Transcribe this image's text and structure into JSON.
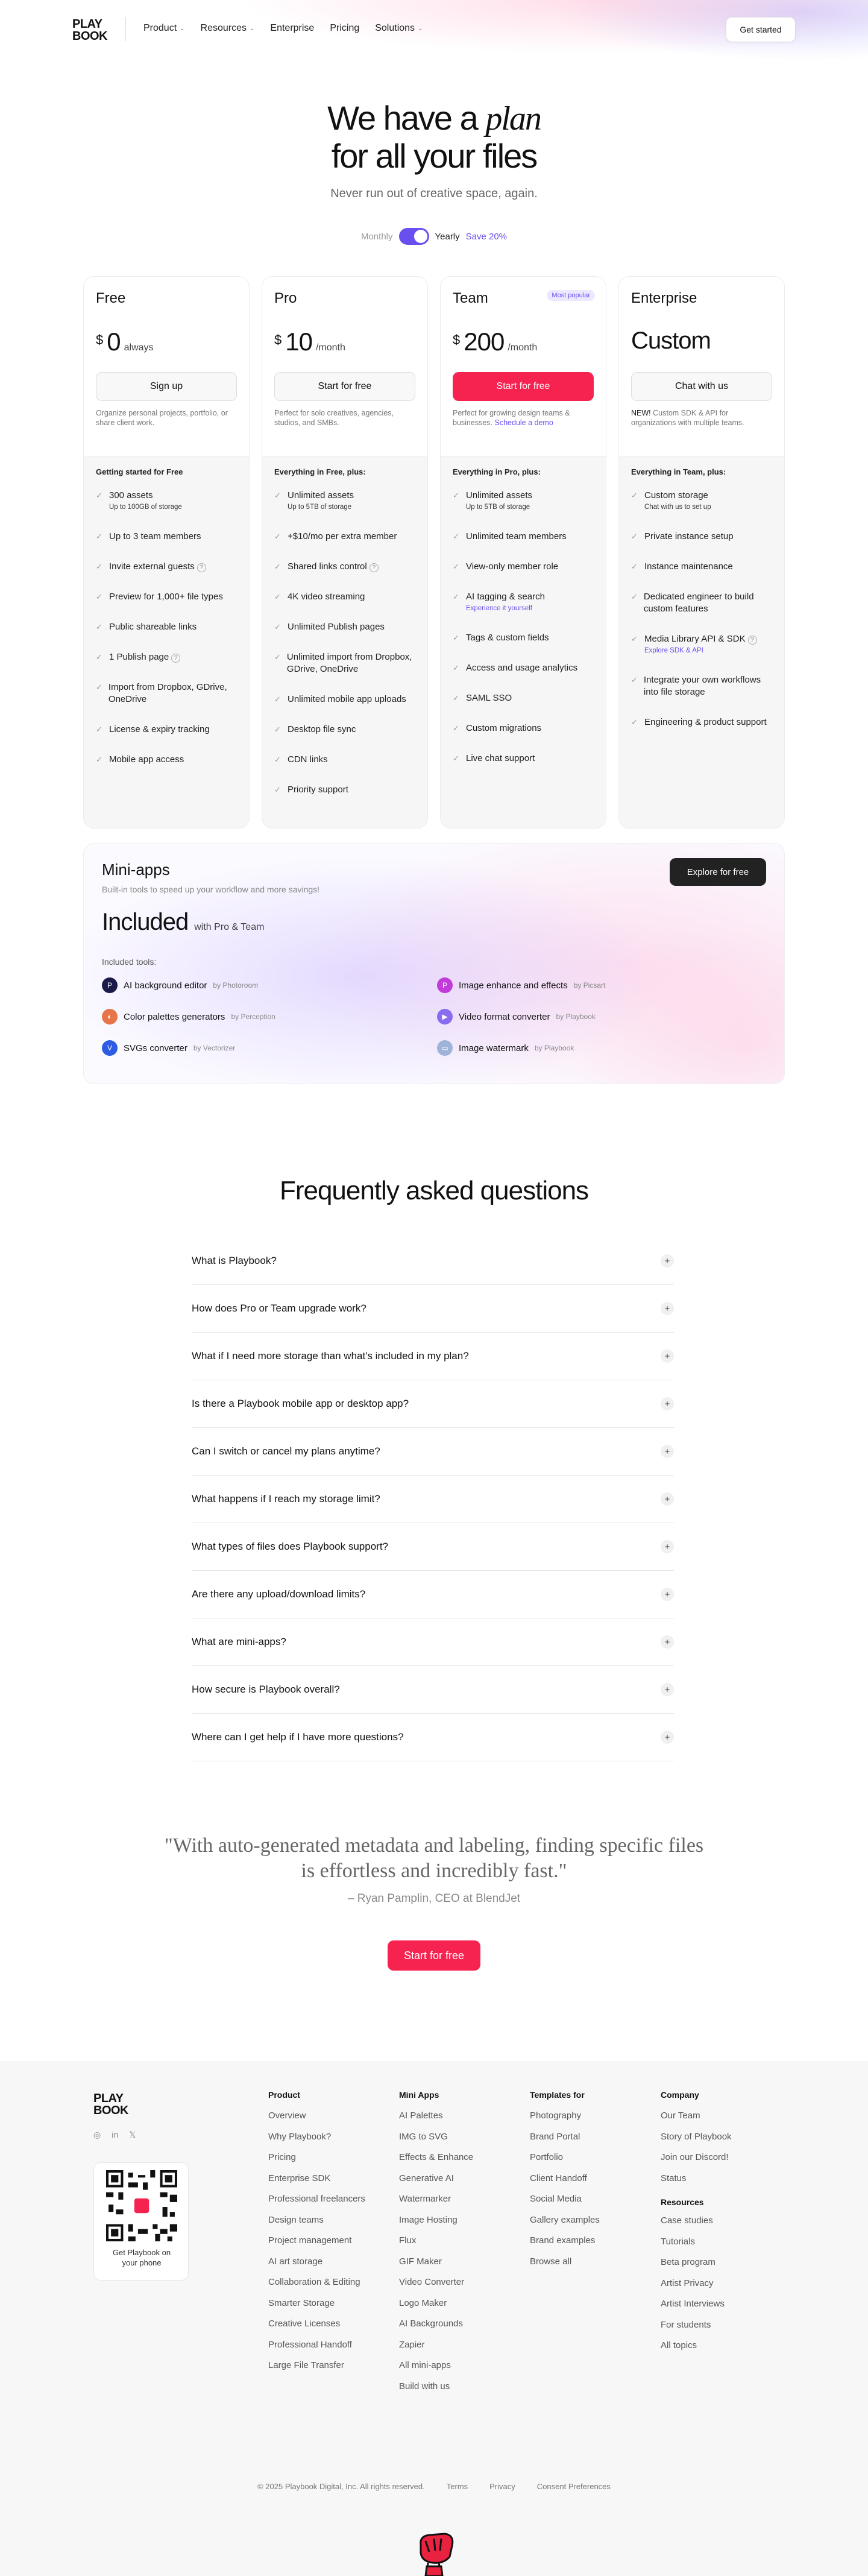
{
  "nav": {
    "logo_line1": "PLAY",
    "logo_line2": "BOOK",
    "links": [
      "Product",
      "Resources",
      "Enterprise",
      "Pricing",
      "Solutions"
    ],
    "cta": "Get started"
  },
  "hero": {
    "title_a": "We have a",
    "title_em": "plan",
    "title_b": "for all your files",
    "subtitle": "Never run out of creative space, again.",
    "toggle_monthly": "Monthly",
    "toggle_yearly": "Yearly",
    "save": "Save 20%"
  },
  "plans": [
    {
      "name": "Free",
      "cur": "$",
      "amount": "0",
      "per": "always",
      "button": "Sign up",
      "desc": "Organize personal projects, portfolio, or share client work.",
      "feat_head": "Getting started for Free",
      "features": [
        {
          "t": "300 assets",
          "s": "Up to 100GB of storage"
        },
        {
          "t": "Up to 3 team members"
        },
        {
          "t": "Invite external guests",
          "info": "?"
        },
        {
          "t": "Preview for 1,000+ file types"
        },
        {
          "t": "Public shareable links"
        },
        {
          "t": "1 Publish page",
          "info": "?"
        },
        {
          "t": "Import from Dropbox, GDrive, OneDrive"
        },
        {
          "t": "License & expiry tracking"
        },
        {
          "t": "Mobile app access"
        }
      ]
    },
    {
      "name": "Pro",
      "cur": "$",
      "amount": "10",
      "per": "/month",
      "button": "Start for free",
      "desc": "Perfect for solo creatives, agencies, studios, and SMBs.",
      "feat_head": "Everything in Free, plus:",
      "features": [
        {
          "t": "Unlimited assets",
          "s": "Up to 5TB of storage"
        },
        {
          "t": "+$10/mo per extra member"
        },
        {
          "t": "Shared links control",
          "info": "?"
        },
        {
          "t": "4K video streaming"
        },
        {
          "t": "Unlimited Publish pages"
        },
        {
          "t": "Unlimited import from Dropbox, GDrive, OneDrive"
        },
        {
          "t": "Unlimited mobile app uploads"
        },
        {
          "t": "Desktop file sync"
        },
        {
          "t": "CDN links"
        },
        {
          "t": "Priority support"
        }
      ]
    },
    {
      "name": "Team",
      "badge": "Most popular",
      "cur": "$",
      "amount": "200",
      "per": "/month",
      "button": "Start for free",
      "desc": "Perfect for growing design teams & businesses.",
      "desc_link": "Schedule a demo",
      "feat_head": "Everything in Pro, plus:",
      "features": [
        {
          "t": "Unlimited assets",
          "s": "Up to 5TB of storage"
        },
        {
          "t": "Unlimited team members"
        },
        {
          "t": "View-only member role"
        },
        {
          "t": "AI tagging & search",
          "p": "Experience it yourself"
        },
        {
          "t": "Tags & custom fields"
        },
        {
          "t": "Access and usage analytics"
        },
        {
          "t": "SAML SSO"
        },
        {
          "t": "Custom migrations"
        },
        {
          "t": "Live chat support"
        }
      ]
    },
    {
      "name": "Enterprise",
      "custom": "Custom",
      "button": "Chat with us",
      "desc_new": "NEW!",
      "desc": " Custom SDK & API for organizations with multiple teams.",
      "feat_head": "Everything in Team, plus:",
      "features": [
        {
          "t": "Custom storage",
          "s": "Chat with us to set up"
        },
        {
          "t": "Private instance setup"
        },
        {
          "t": "Instance maintenance"
        },
        {
          "t": "Dedicated engineer to build custom features"
        },
        {
          "t": "Media Library API & SDK",
          "info": "?",
          "p": "Explore SDK & API"
        },
        {
          "t": "Integrate your own workflows into file storage"
        },
        {
          "t": "Engineering & product support"
        }
      ]
    }
  ],
  "mini": {
    "title": "Mini-apps",
    "subtitle": "Built-in tools to speed up your workflow and more savings!",
    "button": "Explore for free",
    "included": "Included",
    "included_sub": "with Pro & Team",
    "tools_label": "Included tools:",
    "tools": [
      {
        "name": "AI background editor",
        "by": "by Photoroom",
        "color": "#1b1b4a",
        "glyph": "P"
      },
      {
        "name": "Image enhance and effects",
        "by": "by Picsart",
        "color": "#c13bd8",
        "glyph": "P"
      },
      {
        "name": "Color palettes generators",
        "by": "by Perception",
        "color": "#e8744a",
        "glyph": "◐"
      },
      {
        "name": "Video format converter",
        "by": "by Playbook",
        "color": "#8a6cf0",
        "glyph": "▶"
      },
      {
        "name": "SVGs converter",
        "by": "by Vectorizer",
        "color": "#2d5be3",
        "glyph": "V"
      },
      {
        "name": "Image watermark",
        "by": "by Playbook",
        "color": "#9fb3d9",
        "glyph": "▭"
      }
    ]
  },
  "faq": {
    "title": "Frequently asked questions",
    "items": [
      "What is Playbook?",
      "How does Pro or Team upgrade work?",
      "What if I need more storage than what's included in my plan?",
      "Is there a Playbook mobile app or desktop app?",
      "Can I switch or cancel my plans anytime?",
      "What happens if I reach my storage limit?",
      "What types of files does Playbook support?",
      "Are there any upload/download limits?",
      "What are mini-apps?",
      "How secure is Playbook overall?",
      "Where can I get help if I have more questions?"
    ]
  },
  "quote": {
    "line1": "\"With auto-generated metadata and labeling, finding specific files",
    "line2": "is effortless and incredibly fast.\"",
    "by": "– Ryan Pamplin, CEO at BlendJet",
    "button": "Start for free"
  },
  "footer": {
    "logo_line1": "PLAY",
    "logo_line2": "BOOK",
    "social": [
      "◎",
      "in",
      "𝕏"
    ],
    "qr_text_1": "Get Playbook on",
    "qr_text_2": "your phone",
    "product": {
      "title": "Product",
      "items": [
        "Overview",
        "Why Playbook?",
        "Pricing",
        "Enterprise SDK",
        "Professional freelancers",
        "Design teams",
        "Project management",
        "AI art storage",
        "Collaboration & Editing",
        "Smarter Storage",
        "Creative Licenses",
        "Professional Handoff",
        "Large File Transfer"
      ]
    },
    "mini": {
      "title": "Mini Apps",
      "items": [
        "AI Palettes",
        "IMG to SVG",
        "Effects & Enhance",
        "Generative AI",
        "Watermarker",
        "Image Hosting",
        "Flux",
        "GIF Maker",
        "Video Converter",
        "Logo Maker",
        "AI Backgrounds",
        "Zapier",
        "All mini-apps",
        "Build with us"
      ]
    },
    "templates": {
      "title": "Templates for",
      "items": [
        "Photography",
        "Brand Portal",
        "Portfolio",
        "Client Handoff",
        "Social Media",
        "Gallery examples",
        "Brand examples",
        "Browse all"
      ]
    },
    "company": {
      "title": "Company",
      "items": [
        "Our Team",
        "Story of Playbook",
        "Join our Discord!",
        "Status"
      ]
    },
    "resources": {
      "title": "Resources",
      "items": [
        "Case studies",
        "Tutorials",
        "Beta program",
        "Artist Privacy",
        "Artist Interviews",
        "For students",
        "All topics"
      ]
    },
    "copyright": "© 2025 Playbook Digital, Inc. All rights reserved.",
    "terms": "Terms",
    "privacy": "Privacy",
    "consent": "Consent Preferences"
  }
}
